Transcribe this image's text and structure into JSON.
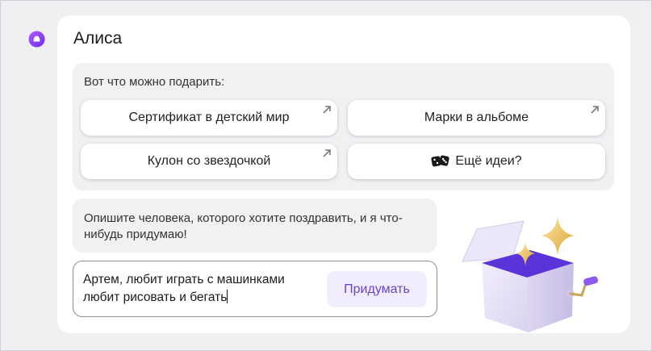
{
  "assistant": {
    "name": "Алиса",
    "brand_color": "#8a3ffc"
  },
  "suggestions": {
    "intro": "Вот что можно подарить:",
    "items": [
      {
        "label": "Сертификат в детский мир",
        "icon": "arrow-up-right-icon"
      },
      {
        "label": "Марки в альбоме",
        "icon": "arrow-up-right-icon"
      },
      {
        "label": "Кулон со звездочкой",
        "icon": "arrow-up-right-icon"
      },
      {
        "label": "Ещё идеи?",
        "icon": "dice-icon"
      }
    ]
  },
  "prompt": {
    "text": "Опишите человека, которого хотите поздравить, и я что-нибудь придумаю!"
  },
  "input": {
    "value_line1": "Артем, любит играть с машинками",
    "value_line2": "любит рисовать и бегать"
  },
  "submit": {
    "label": "Придумать"
  },
  "colors": {
    "card_bg": "#ffffff",
    "panel_bg": "#f1f1f4",
    "accent": "#6b44c8",
    "accent_bg": "#f1edff"
  }
}
